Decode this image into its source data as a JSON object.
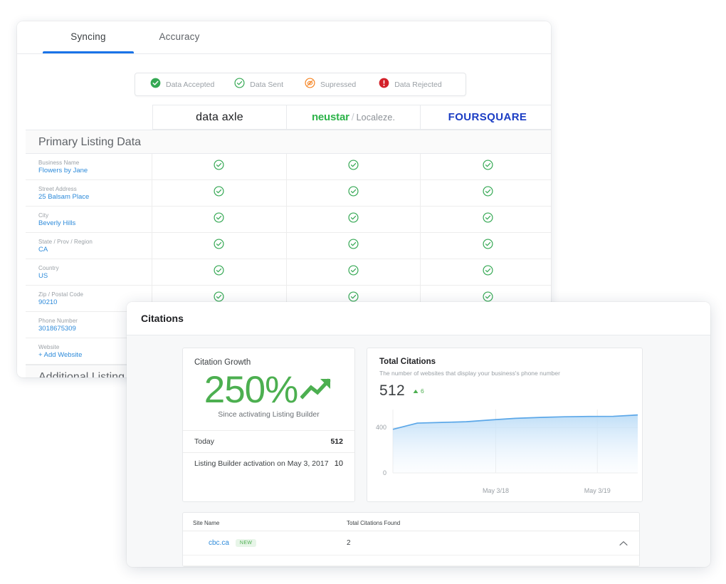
{
  "syncing_card": {
    "tabs": [
      {
        "label": "Syncing",
        "active": true
      },
      {
        "label": "Accuracy",
        "active": false
      }
    ],
    "legend": [
      {
        "label": "Data Accepted",
        "icon": "check-circle-filled-icon",
        "color": "#34a853"
      },
      {
        "label": "Data Sent",
        "icon": "check-circle-outline-icon",
        "color": "#34a853"
      },
      {
        "label": "Supressed",
        "icon": "eye-off-circle-icon",
        "color": "#f5821f"
      },
      {
        "label": "Data Rejected",
        "icon": "exclamation-circle-filled-icon",
        "color": "#d32029"
      }
    ],
    "providers": [
      {
        "name": "data axle",
        "style": "dataaxle"
      },
      {
        "name": "neustar",
        "secondary": "Localeze.",
        "style": "neustar"
      },
      {
        "name": "FOURSQUARE",
        "style": "foursquare"
      }
    ],
    "sections": [
      {
        "title": "Primary Listing Data",
        "rows": [
          {
            "label": "Business Name",
            "value": "Flowers by Jane",
            "statuses": [
              "check-circle-outline-icon",
              "check-circle-outline-icon",
              "check-circle-outline-icon"
            ]
          },
          {
            "label": "Street Address",
            "value": "25 Balsam Place",
            "statuses": [
              "check-circle-outline-icon",
              "check-circle-outline-icon",
              "check-circle-outline-icon"
            ]
          },
          {
            "label": "City",
            "value": "Beverly Hills",
            "statuses": [
              "check-circle-outline-icon",
              "check-circle-outline-icon",
              "check-circle-outline-icon"
            ]
          },
          {
            "label": "State / Prov / Region",
            "value": "CA",
            "statuses": [
              "check-circle-outline-icon",
              "check-circle-outline-icon",
              "check-circle-outline-icon"
            ]
          },
          {
            "label": "Country",
            "value": "US",
            "statuses": [
              "check-circle-outline-icon",
              "check-circle-outline-icon",
              "check-circle-outline-icon"
            ]
          },
          {
            "label": "Zip / Postal Code",
            "value": "90210",
            "statuses": [
              "check-circle-outline-icon",
              "check-circle-outline-icon",
              "check-circle-outline-icon"
            ]
          },
          {
            "label": "Phone Number",
            "value": "3018675309",
            "statuses": [
              "check-circle-outline-icon",
              "check-circle-outline-icon",
              "check-circle-outline-icon"
            ]
          },
          {
            "label": "Website",
            "value": "+ Add Website",
            "statuses": [
              "check-circle-outline-icon",
              "check-circle-outline-icon",
              "check-circle-outline-icon"
            ]
          }
        ]
      },
      {
        "title": "Additional Listing Data",
        "rows": []
      }
    ]
  },
  "citations_panel": {
    "title": "Citations",
    "growth": {
      "title": "Citation Growth",
      "percent": "250%",
      "arrow_icon": "trending-up-icon",
      "subtitle": "Since activating Listing Builder",
      "stats": [
        {
          "label": "Today",
          "value": "512"
        },
        {
          "label": "Listing Builder activation on May 3, 2017",
          "value": "10"
        }
      ]
    },
    "total": {
      "title": "Total Citations",
      "subtitle": "The number of websites that display your business's phone number",
      "value": "512",
      "delta": "6",
      "delta_icon": "triangle-up-icon",
      "delta_color": "#4caf50"
    },
    "sites": {
      "columns": [
        "Site Name",
        "Total Citations Found"
      ],
      "rows": [
        {
          "site": "cbc.ca",
          "badge": "NEW",
          "count": "2",
          "chevron": "chevron-up-icon"
        }
      ]
    }
  },
  "chart_data": {
    "type": "area",
    "title": "Total Citations",
    "subtitle": "The number of websites that display your business's phone number",
    "xlabel": "",
    "ylabel": "",
    "ylim": [
      0,
      560
    ],
    "yticks": [
      0,
      400
    ],
    "ytick_labels": [
      "0",
      "400"
    ],
    "grid": true,
    "legend": "none",
    "x_tick_labels": [
      "May 3/18",
      "May 3/19"
    ],
    "x": [
      0,
      1,
      2,
      3,
      4,
      5,
      6,
      7,
      8,
      9,
      10
    ],
    "values": [
      385,
      440,
      446,
      452,
      468,
      482,
      490,
      496,
      499,
      500,
      512
    ],
    "line_color": "#5ba7e8",
    "fill_color": "#cfe5f8"
  }
}
